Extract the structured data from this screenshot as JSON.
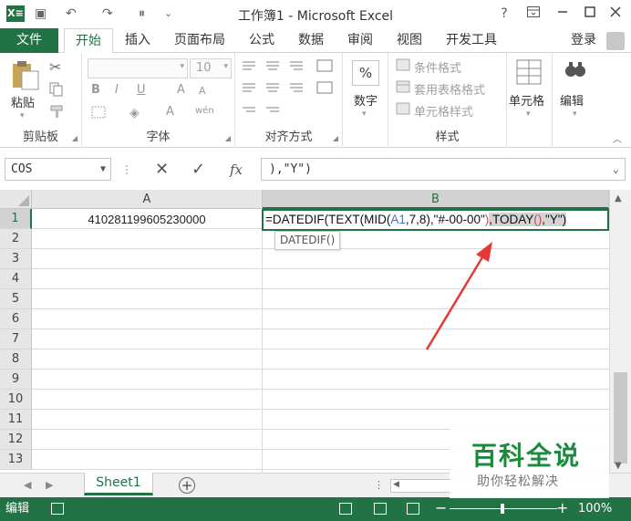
{
  "app": {
    "window_title": "工作簿1 - Microsoft Excel",
    "logo_text": "X≡",
    "help": "?",
    "qat": {
      "save": "▣",
      "undo": "↶",
      "redo": "↷",
      "touch": "⏸",
      "customize": "⌄"
    }
  },
  "tabs": {
    "file": "文件",
    "items": [
      "开始",
      "插入",
      "页面布局",
      "公式",
      "数据",
      "审阅",
      "视图",
      "开发工具"
    ],
    "login": "登录"
  },
  "ribbon": {
    "clipboard": {
      "label": "剪贴板",
      "paste": "粘贴"
    },
    "font": {
      "label": "字体",
      "size": "10",
      "bold": "B",
      "italic": "I",
      "underline": "U",
      "grow": "A",
      "shrink": "A",
      "phonetic": "wén"
    },
    "alignment": {
      "label": "对齐方式"
    },
    "number": {
      "label": "数字",
      "icon_text": "%"
    },
    "styles": {
      "label": "样式",
      "conditional": "条件格式",
      "table": "套用表格格式",
      "cell": "单元格样式"
    },
    "cells": {
      "label": "单元格"
    },
    "editing": {
      "label": "编辑"
    }
  },
  "formula_bar": {
    "name_box": "COS",
    "cancel": "✕",
    "enter": "✓",
    "fx": "fx",
    "content": "),\"Y\")"
  },
  "grid": {
    "columns": [
      "A",
      "B"
    ],
    "rows": [
      "1",
      "2",
      "3",
      "4",
      "5",
      "6",
      "7",
      "8",
      "9",
      "10",
      "11",
      "12",
      "13"
    ],
    "a1": "410281199605230000",
    "b1": {
      "p1": "=DATEDIF(TEXT(MID(",
      "p2": "A1",
      "p3": ",7,8),\"#-00-00\"",
      "p4": ")",
      "p5": ",TODAY",
      "p6": "()",
      "p7": ",\"Y\")"
    },
    "tooltip": "DATEDIF()"
  },
  "sheets": {
    "tabs": [
      "Sheet1"
    ],
    "add": "+"
  },
  "status": {
    "mode": "编辑",
    "zoom": "100%"
  },
  "watermark": {
    "title": "百科全说",
    "subtitle": "助你轻松解决"
  },
  "colors": {
    "excel_green": "#217346",
    "annotation_arrow": "#e53935",
    "ref_blue": "#4472c4",
    "paren_red": "#c0504d"
  }
}
